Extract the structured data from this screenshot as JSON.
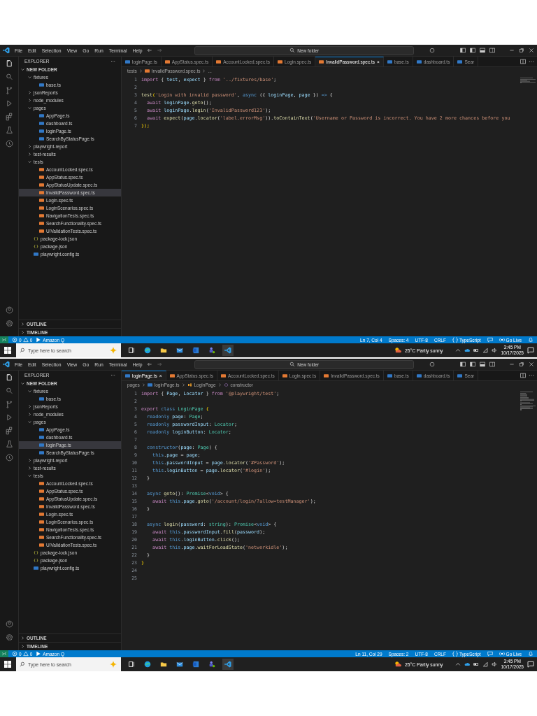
{
  "shots": [
    {
      "menu": [
        "File",
        "Edit",
        "Selection",
        "View",
        "Go",
        "Run",
        "Terminal",
        "Help"
      ],
      "search": "New folder",
      "explorer": {
        "title": "EXPLORER",
        "more": "···",
        "root": "NEW FOLDER",
        "outline": "OUTLINE",
        "timeline": "TIMELINE",
        "items": [
          {
            "label": "fixtures",
            "kind": "folder",
            "expanded": true,
            "selected": false,
            "children": [
              {
                "label": "base.ts",
                "kind": "ts",
                "selected": false
              }
            ]
          },
          {
            "label": "jsonReports",
            "kind": "folder",
            "expanded": false,
            "selected": false
          },
          {
            "label": "node_modules",
            "kind": "folder",
            "expanded": false,
            "selected": false
          },
          {
            "label": "pages",
            "kind": "folder",
            "expanded": true,
            "selected": false,
            "children": [
              {
                "label": "AppPage.ts",
                "kind": "ts",
                "selected": false
              },
              {
                "label": "dashboard.ts",
                "kind": "ts",
                "selected": false
              },
              {
                "label": "loginPage.ts",
                "kind": "ts",
                "selected": false
              },
              {
                "label": "SearchByStatusPage.ts",
                "kind": "ts",
                "selected": false
              }
            ]
          },
          {
            "label": "playwright-report",
            "kind": "folder",
            "expanded": false,
            "selected": false
          },
          {
            "label": "test-results",
            "kind": "folder",
            "expanded": false,
            "selected": false
          },
          {
            "label": "tests",
            "kind": "folder",
            "expanded": true,
            "selected": false,
            "children": [
              {
                "label": "AccountLocked.spec.ts",
                "kind": "spec",
                "selected": false
              },
              {
                "label": "AppStatus.spec.ts",
                "kind": "spec",
                "selected": false
              },
              {
                "label": "AppStatusUpdate.spec.ts",
                "kind": "spec",
                "selected": false
              },
              {
                "label": "InvalidPassword.spec.ts",
                "kind": "spec",
                "selected": true
              },
              {
                "label": "Login.spec.ts",
                "kind": "spec",
                "selected": false
              },
              {
                "label": "LoginScenarios.spec.ts",
                "kind": "spec",
                "selected": false
              },
              {
                "label": "NavigationTests.spec.ts",
                "kind": "spec",
                "selected": false
              },
              {
                "label": "SearchFunctionality.spec.ts",
                "kind": "spec",
                "selected": false
              },
              {
                "label": "UIValidationTests.spec.ts",
                "kind": "spec",
                "selected": false
              }
            ]
          },
          {
            "label": "package-lock.json",
            "kind": "json",
            "selected": false
          },
          {
            "label": "package.json",
            "kind": "json",
            "selected": false
          },
          {
            "label": "playwright.config.ts",
            "kind": "ts",
            "selected": false
          }
        ]
      },
      "tabs": [
        {
          "label": "loginPage.ts",
          "kind": "ts",
          "selected": false
        },
        {
          "label": "AppStatus.spec.ts",
          "kind": "spec",
          "selected": false
        },
        {
          "label": "AccountLocked.spec.ts",
          "kind": "spec",
          "selected": false
        },
        {
          "label": "Login.spec.ts",
          "kind": "spec",
          "selected": false
        },
        {
          "label": "InvalidPassword.spec.ts",
          "kind": "spec",
          "selected": true,
          "close": "×"
        },
        {
          "label": "base.ts",
          "kind": "ts",
          "selected": false
        },
        {
          "label": "dashboard.ts",
          "kind": "ts",
          "selected": false
        },
        {
          "label": "Sear",
          "kind": "ts",
          "selected": false
        }
      ],
      "breadcrumb": [
        {
          "text": "tests",
          "kind": "plain"
        },
        {
          "text": "InvalidPassword.spec.ts",
          "kind": "spec"
        },
        {
          "text": "...",
          "kind": "plain"
        }
      ],
      "code": [
        {
          "number": "1",
          "segments": [
            {
              "kind": "control",
              "text": "import"
            },
            {
              "kind": "plain",
              "text": " { "
            },
            {
              "kind": "variable",
              "text": "test"
            },
            {
              "kind": "plain",
              "text": ", "
            },
            {
              "kind": "variable",
              "text": "expect"
            },
            {
              "kind": "plain",
              "text": " } "
            },
            {
              "kind": "control",
              "text": "from"
            },
            {
              "kind": "string",
              "text": " '../fixtures/base'"
            },
            {
              "kind": "plain",
              "text": ";"
            }
          ]
        },
        {
          "number": "2"
        },
        {
          "number": "3",
          "segments": [
            {
              "kind": "function",
              "text": "test"
            },
            {
              "kind": "punct",
              "text": "("
            },
            {
              "kind": "string",
              "text": "'Login with invalid password'"
            },
            {
              "kind": "plain",
              "text": ", "
            },
            {
              "kind": "keyword",
              "text": "async"
            },
            {
              "kind": "plain",
              "text": " ({ "
            },
            {
              "kind": "variable",
              "text": "loginPage"
            },
            {
              "kind": "plain",
              "text": ", "
            },
            {
              "kind": "variable",
              "text": "page"
            },
            {
              "kind": "plain",
              "text": " }) "
            },
            {
              "kind": "keyword",
              "text": "=>"
            },
            {
              "kind": "plain",
              "text": " {"
            }
          ]
        },
        {
          "number": "4",
          "segments": [
            {
              "kind": "control",
              "text": "  await"
            },
            {
              "kind": "variable",
              "text": " loginPage"
            },
            {
              "kind": "plain",
              "text": "."
            },
            {
              "kind": "function",
              "text": "goto"
            },
            {
              "kind": "plain",
              "text": "();"
            }
          ]
        },
        {
          "number": "5",
          "segments": [
            {
              "kind": "control",
              "text": "  await"
            },
            {
              "kind": "variable",
              "text": " loginPage"
            },
            {
              "kind": "plain",
              "text": "."
            },
            {
              "kind": "function",
              "text": "login"
            },
            {
              "kind": "plain",
              "text": "("
            },
            {
              "kind": "string",
              "text": "'InvalidPassword123'"
            },
            {
              "kind": "plain",
              "text": ");"
            }
          ]
        },
        {
          "number": "6",
          "segments": [
            {
              "kind": "control",
              "text": "  await"
            },
            {
              "kind": "function",
              "text": " expect"
            },
            {
              "kind": "plain",
              "text": "("
            },
            {
              "kind": "variable",
              "text": "page"
            },
            {
              "kind": "plain",
              "text": "."
            },
            {
              "kind": "function",
              "text": "locator"
            },
            {
              "kind": "plain",
              "text": "("
            },
            {
              "kind": "string",
              "text": "'label.errorMsg'"
            },
            {
              "kind": "plain",
              "text": "))."
            },
            {
              "kind": "function",
              "text": "toContainText"
            },
            {
              "kind": "plain",
              "text": "("
            },
            {
              "kind": "string",
              "text": "'Username or Password is incorrect. You have 2 more chances before you"
            }
          ]
        },
        {
          "number": "7",
          "segments": [
            {
              "kind": "punct",
              "text": "});"
            }
          ]
        }
      ],
      "status": {
        "errors": "0",
        "warnings": "0",
        "left": [
          {
            "kind": "amazon",
            "text": "Amazon Q"
          }
        ],
        "right": [
          {
            "kind": "plain",
            "text": "Ln 7, Col 4"
          },
          {
            "kind": "plain",
            "text": "Spaces: 4"
          },
          {
            "kind": "plain",
            "text": "UTF-8"
          },
          {
            "kind": "plain",
            "text": "CRLF"
          },
          {
            "kind": "braces",
            "text": "TypeScript"
          },
          {
            "kind": "feedback"
          },
          {
            "kind": "live",
            "text": "Go Live"
          },
          {
            "kind": "bell"
          }
        ]
      },
      "taskbar": {
        "search": "Type here to search",
        "weather": "25°C  Partly sunny",
        "time": "3:45 PM",
        "date": "10/17/2025"
      }
    },
    {
      "menu": [
        "File",
        "Edit",
        "Selection",
        "View",
        "Go",
        "Run",
        "Terminal",
        "Help"
      ],
      "search": "New folder",
      "explorer": {
        "title": "EXPLORER",
        "more": "···",
        "root": "NEW FOLDER",
        "outline": "OUTLINE",
        "timeline": "TIMELINE",
        "items": [
          {
            "label": "fixtures",
            "kind": "folder",
            "expanded": true,
            "selected": false,
            "children": [
              {
                "label": "base.ts",
                "kind": "ts",
                "selected": false
              }
            ]
          },
          {
            "label": "jsonReports",
            "kind": "folder",
            "expanded": false,
            "selected": false
          },
          {
            "label": "node_modules",
            "kind": "folder",
            "expanded": false,
            "selected": false
          },
          {
            "label": "pages",
            "kind": "folder",
            "expanded": true,
            "selected": false,
            "children": [
              {
                "label": "AppPage.ts",
                "kind": "ts",
                "selected": false
              },
              {
                "label": "dashboard.ts",
                "kind": "ts",
                "selected": false
              },
              {
                "label": "loginPage.ts",
                "kind": "ts",
                "selected": true
              },
              {
                "label": "SearchByStatusPage.ts",
                "kind": "ts",
                "selected": false
              }
            ]
          },
          {
            "label": "playwright-report",
            "kind": "folder",
            "expanded": false,
            "selected": false
          },
          {
            "label": "test-results",
            "kind": "folder",
            "expanded": false,
            "selected": false
          },
          {
            "label": "tests",
            "kind": "folder",
            "expanded": true,
            "selected": false,
            "children": [
              {
                "label": "AccountLocked.spec.ts",
                "kind": "spec",
                "selected": false
              },
              {
                "label": "AppStatus.spec.ts",
                "kind": "spec",
                "selected": false
              },
              {
                "label": "AppStatusUpdate.spec.ts",
                "kind": "spec",
                "selected": false
              },
              {
                "label": "InvalidPassword.spec.ts",
                "kind": "spec",
                "selected": false
              },
              {
                "label": "Login.spec.ts",
                "kind": "spec",
                "selected": false
              },
              {
                "label": "LoginScenarios.spec.ts",
                "kind": "spec",
                "selected": false
              },
              {
                "label": "NavigationTests.spec.ts",
                "kind": "spec",
                "selected": false
              },
              {
                "label": "SearchFunctionality.spec.ts",
                "kind": "spec",
                "selected": false
              },
              {
                "label": "UIValidationTests.spec.ts",
                "kind": "spec",
                "selected": false
              }
            ]
          },
          {
            "label": "package-lock.json",
            "kind": "json",
            "selected": false
          },
          {
            "label": "package.json",
            "kind": "json",
            "selected": false
          },
          {
            "label": "playwright.config.ts",
            "kind": "ts",
            "selected": false
          }
        ]
      },
      "tabs": [
        {
          "label": "loginPage.ts",
          "kind": "ts",
          "selected": true,
          "close": "×"
        },
        {
          "label": "AppStatus.spec.ts",
          "kind": "spec",
          "selected": false
        },
        {
          "label": "AccountLocked.spec.ts",
          "kind": "spec",
          "selected": false
        },
        {
          "label": "Login.spec.ts",
          "kind": "spec",
          "selected": false
        },
        {
          "label": "InvalidPassword.spec.ts",
          "kind": "spec",
          "selected": false
        },
        {
          "label": "base.ts",
          "kind": "ts",
          "selected": false
        },
        {
          "label": "dashboard.ts",
          "kind": "ts",
          "selected": false
        },
        {
          "label": "Sear",
          "kind": "ts",
          "selected": false
        }
      ],
      "breadcrumb": [
        {
          "text": "pages",
          "kind": "plain"
        },
        {
          "text": "loginPage.ts",
          "kind": "ts"
        },
        {
          "text": "LoginPage",
          "kind": "class"
        },
        {
          "text": "constructor",
          "kind": "method"
        }
      ],
      "code": [
        {
          "number": "1",
          "segments": [
            {
              "kind": "control",
              "text": "import"
            },
            {
              "kind": "plain",
              "text": " { "
            },
            {
              "kind": "variable",
              "text": "Page"
            },
            {
              "kind": "plain",
              "text": ", "
            },
            {
              "kind": "variable",
              "text": "Locator"
            },
            {
              "kind": "plain",
              "text": " } "
            },
            {
              "kind": "control",
              "text": "from"
            },
            {
              "kind": "string",
              "text": " '@playwright/test'"
            },
            {
              "kind": "plain",
              "text": ";"
            }
          ]
        },
        {
          "number": "2"
        },
        {
          "number": "3",
          "segments": [
            {
              "kind": "control",
              "text": "export"
            },
            {
              "kind": "keyword",
              "text": " class"
            },
            {
              "kind": "type",
              "text": " LoginPage"
            },
            {
              "kind": "punct",
              "text": " {"
            }
          ]
        },
        {
          "number": "4",
          "segments": [
            {
              "kind": "keyword",
              "text": "  readonly"
            },
            {
              "kind": "variable",
              "text": " page"
            },
            {
              "kind": "plain",
              "text": ": "
            },
            {
              "kind": "type",
              "text": "Page"
            },
            {
              "kind": "plain",
              "text": ";"
            }
          ]
        },
        {
          "number": "5",
          "segments": [
            {
              "kind": "keyword",
              "text": "  readonly"
            },
            {
              "kind": "variable",
              "text": " passwordInput"
            },
            {
              "kind": "plain",
              "text": ": "
            },
            {
              "kind": "type",
              "text": "Locator"
            },
            {
              "kind": "plain",
              "text": ";"
            }
          ]
        },
        {
          "number": "6",
          "segments": [
            {
              "kind": "keyword",
              "text": "  readonly"
            },
            {
              "kind": "variable",
              "text": " loginButton"
            },
            {
              "kind": "plain",
              "text": ": "
            },
            {
              "kind": "type",
              "text": "Locator"
            },
            {
              "kind": "plain",
              "text": ";"
            }
          ]
        },
        {
          "number": "7"
        },
        {
          "number": "8",
          "segments": [
            {
              "kind": "keyword",
              "text": "  constructor"
            },
            {
              "kind": "plain",
              "text": "("
            },
            {
              "kind": "variable",
              "text": "page"
            },
            {
              "kind": "plain",
              "text": ": "
            },
            {
              "kind": "type",
              "text": "Page"
            },
            {
              "kind": "plain",
              "text": ") {"
            }
          ]
        },
        {
          "number": "9",
          "segments": [
            {
              "kind": "keyword",
              "text": "    this"
            },
            {
              "kind": "plain",
              "text": "."
            },
            {
              "kind": "variable",
              "text": "page"
            },
            {
              "kind": "plain",
              "text": " = "
            },
            {
              "kind": "variable",
              "text": "page"
            },
            {
              "kind": "plain",
              "text": ";"
            }
          ]
        },
        {
          "number": "10",
          "segments": [
            {
              "kind": "keyword",
              "text": "    this"
            },
            {
              "kind": "plain",
              "text": "."
            },
            {
              "kind": "variable",
              "text": "passwordInput"
            },
            {
              "kind": "plain",
              "text": " = "
            },
            {
              "kind": "variable",
              "text": "page"
            },
            {
              "kind": "plain",
              "text": "."
            },
            {
              "kind": "function",
              "text": "locator"
            },
            {
              "kind": "plain",
              "text": "("
            },
            {
              "kind": "string",
              "text": "'#Password'"
            },
            {
              "kind": "plain",
              "text": ");"
            }
          ]
        },
        {
          "number": "11",
          "segments": [
            {
              "kind": "keyword",
              "text": "    this"
            },
            {
              "kind": "plain",
              "text": "."
            },
            {
              "kind": "variable",
              "text": "loginButton"
            },
            {
              "kind": "plain",
              "text": " = "
            },
            {
              "kind": "variable",
              "text": "page"
            },
            {
              "kind": "plain",
              "text": "."
            },
            {
              "kind": "function",
              "text": "locator"
            },
            {
              "kind": "plain",
              "text": "("
            },
            {
              "kind": "string",
              "text": "'#login'"
            },
            {
              "kind": "plain",
              "text": ");"
            }
          ]
        },
        {
          "number": "12",
          "segments": [
            {
              "kind": "plain",
              "text": "  }"
            }
          ]
        },
        {
          "number": "13"
        },
        {
          "number": "14",
          "segments": [
            {
              "kind": "keyword",
              "text": "  async"
            },
            {
              "kind": "function",
              "text": " goto"
            },
            {
              "kind": "plain",
              "text": "(): "
            },
            {
              "kind": "type",
              "text": "Promise"
            },
            {
              "kind": "plain",
              "text": "<"
            },
            {
              "kind": "keyword",
              "text": "void"
            },
            {
              "kind": "plain",
              "text": "> {"
            }
          ]
        },
        {
          "number": "15",
          "segments": [
            {
              "kind": "control",
              "text": "    await"
            },
            {
              "kind": "keyword",
              "text": " this"
            },
            {
              "kind": "plain",
              "text": "."
            },
            {
              "kind": "variable",
              "text": "page"
            },
            {
              "kind": "plain",
              "text": "."
            },
            {
              "kind": "function",
              "text": "goto"
            },
            {
              "kind": "plain",
              "text": "("
            },
            {
              "kind": "string",
              "text": "'/account/login/?allow=testManager'"
            },
            {
              "kind": "plain",
              "text": ");"
            }
          ]
        },
        {
          "number": "16",
          "segments": [
            {
              "kind": "plain",
              "text": "  }"
            }
          ]
        },
        {
          "number": "17"
        },
        {
          "number": "18",
          "segments": [
            {
              "kind": "keyword",
              "text": "  async"
            },
            {
              "kind": "function",
              "text": " login"
            },
            {
              "kind": "plain",
              "text": "("
            },
            {
              "kind": "variable",
              "text": "password"
            },
            {
              "kind": "plain",
              "text": ": "
            },
            {
              "kind": "type",
              "text": "string"
            },
            {
              "kind": "plain",
              "text": "): "
            },
            {
              "kind": "type",
              "text": "Promise"
            },
            {
              "kind": "plain",
              "text": "<"
            },
            {
              "kind": "keyword",
              "text": "void"
            },
            {
              "kind": "plain",
              "text": "> {"
            }
          ]
        },
        {
          "number": "19",
          "segments": [
            {
              "kind": "control",
              "text": "    await"
            },
            {
              "kind": "keyword",
              "text": " this"
            },
            {
              "kind": "plain",
              "text": "."
            },
            {
              "kind": "variable",
              "text": "passwordInput"
            },
            {
              "kind": "plain",
              "text": "."
            },
            {
              "kind": "function",
              "text": "fill"
            },
            {
              "kind": "plain",
              "text": "("
            },
            {
              "kind": "variable",
              "text": "password"
            },
            {
              "kind": "plain",
              "text": ");"
            }
          ]
        },
        {
          "number": "20",
          "segments": [
            {
              "kind": "control",
              "text": "    await"
            },
            {
              "kind": "keyword",
              "text": " this"
            },
            {
              "kind": "plain",
              "text": "."
            },
            {
              "kind": "variable",
              "text": "loginButton"
            },
            {
              "kind": "plain",
              "text": "."
            },
            {
              "kind": "function",
              "text": "click"
            },
            {
              "kind": "plain",
              "text": "();"
            }
          ]
        },
        {
          "number": "21",
          "segments": [
            {
              "kind": "control",
              "text": "    await"
            },
            {
              "kind": "keyword",
              "text": " this"
            },
            {
              "kind": "plain",
              "text": "."
            },
            {
              "kind": "variable",
              "text": "page"
            },
            {
              "kind": "plain",
              "text": "."
            },
            {
              "kind": "function",
              "text": "waitForLoadState"
            },
            {
              "kind": "plain",
              "text": "("
            },
            {
              "kind": "string",
              "text": "'networkidle'"
            },
            {
              "kind": "plain",
              "text": ");"
            }
          ]
        },
        {
          "number": "22",
          "segments": [
            {
              "kind": "plain",
              "text": "  }"
            }
          ]
        },
        {
          "number": "23",
          "segments": [
            {
              "kind": "punct",
              "text": "}"
            }
          ]
        },
        {
          "number": "24"
        },
        {
          "number": "25"
        }
      ],
      "status": {
        "errors": "0",
        "warnings": "0",
        "left": [
          {
            "kind": "amazon",
            "text": "Amazon Q"
          }
        ],
        "right": [
          {
            "kind": "plain",
            "text": "Ln 11, Col 29"
          },
          {
            "kind": "plain",
            "text": "Spaces: 2"
          },
          {
            "kind": "plain",
            "text": "UTF-8"
          },
          {
            "kind": "plain",
            "text": "CRLF"
          },
          {
            "kind": "braces",
            "text": "TypeScript"
          },
          {
            "kind": "feedback"
          },
          {
            "kind": "live",
            "text": "Go Live"
          },
          {
            "kind": "bell"
          }
        ]
      },
      "taskbar": {
        "search": "Type here to search",
        "weather": "25°C  Partly sunny",
        "time": "3:45 PM",
        "date": "10/17/2025"
      }
    }
  ]
}
